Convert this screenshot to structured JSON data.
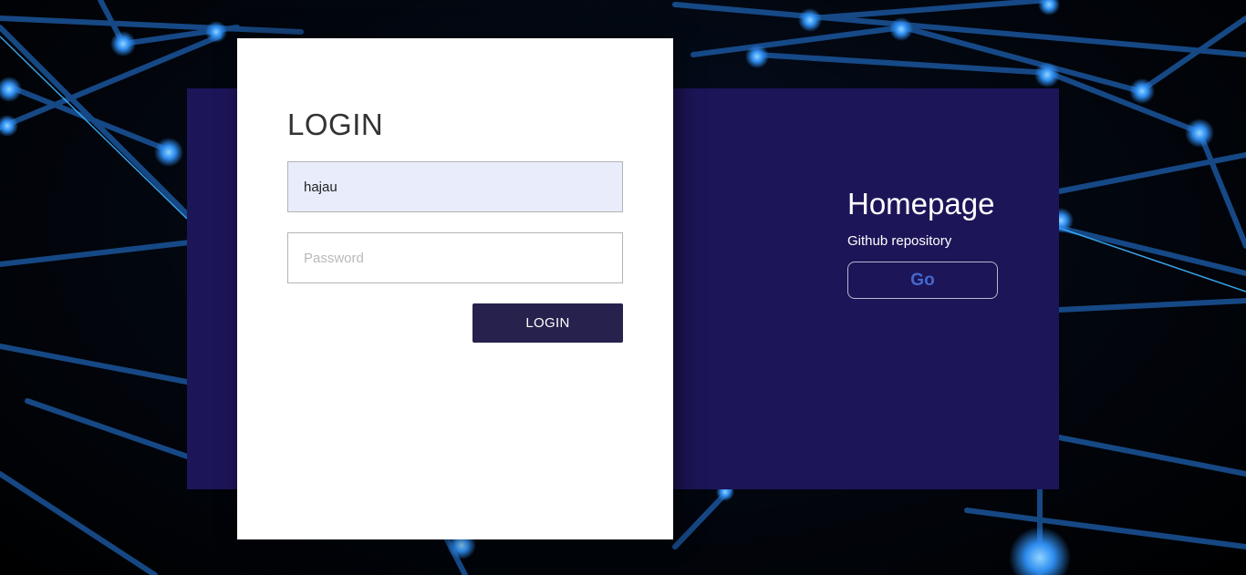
{
  "background": {
    "icon": "network-nodes-background",
    "colors": {
      "node": "#3aa0ff",
      "line": "#1e5fb0"
    }
  },
  "login": {
    "title": "LOGIN",
    "username_value": "hajau",
    "password_placeholder": "Password",
    "submit_label": "LOGIN"
  },
  "homepage": {
    "title": "Homepage",
    "subtitle": "Github repository",
    "go_label": "Go"
  },
  "colors": {
    "panel": "#1c1558",
    "button": "#27214d",
    "autofill": "#e8ecfb",
    "go_text": "#4468cc"
  }
}
